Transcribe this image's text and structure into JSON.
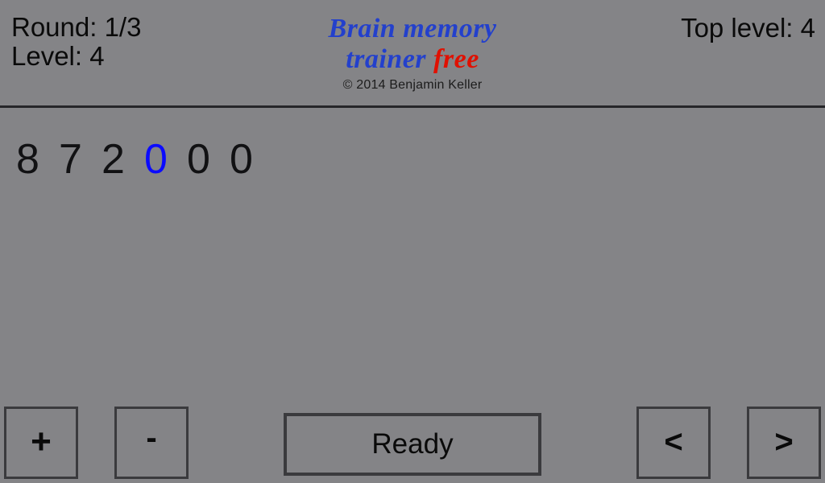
{
  "app": {
    "background_color": "#848487",
    "text_color": "#0a0a0a"
  },
  "header": {
    "round_label": "Round: 1/3",
    "level_label": "Level: 4",
    "top_level_label": "Top level: 4",
    "brand_line1": "Brain memory",
    "brand_line2": "trainer",
    "brand_free": "free",
    "brand_color": "#2340cc",
    "free_color": "#e01000",
    "copyright": "© 2014 Benjamin Keller"
  },
  "main": {
    "digits": [
      {
        "value": "8",
        "active": false
      },
      {
        "value": "7",
        "active": false
      },
      {
        "value": "2",
        "active": false
      },
      {
        "value": "0",
        "active": true
      },
      {
        "value": "0",
        "active": false
      },
      {
        "value": "0",
        "active": false
      }
    ],
    "active_digit_color": "#0b0bff",
    "digit_color": "#111113"
  },
  "buttons": {
    "plus": "+",
    "minus": "-",
    "ready": "Ready",
    "prev": "<",
    "next": ">"
  }
}
